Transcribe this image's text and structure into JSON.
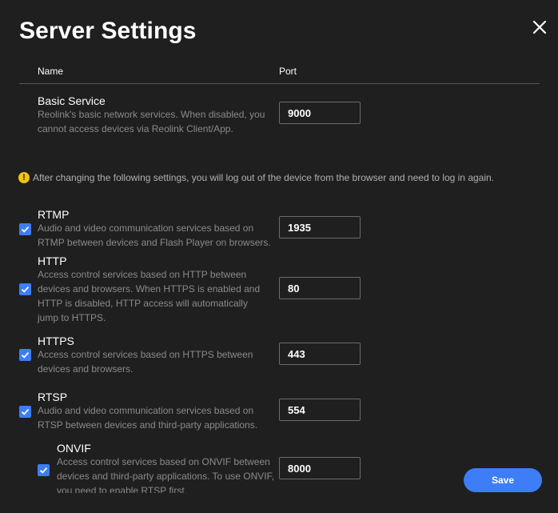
{
  "dialog": {
    "title": "Server Settings",
    "close_icon": "close-icon"
  },
  "table": {
    "col_name": "Name",
    "col_port": "Port"
  },
  "basic_service": {
    "title": "Basic Service",
    "description": "Reolink's basic network services. When disabled, you cannot access devices via Reolink Client/App.",
    "port": "9000"
  },
  "notice": {
    "icon": "warning-icon",
    "text": "After changing the following settings, you will log out of the device from the browser and need to log in again."
  },
  "services": {
    "rtmp": {
      "title": "RTMP",
      "description": "Audio and video communication services based on RTMP between devices and Flash Player on browsers.",
      "port": "1935",
      "enabled": true
    },
    "http": {
      "title": "HTTP",
      "description": "Access control services based on HTTP between devices and browsers. When HTTPS is enabled and HTTP is disabled, HTTP access will automatically jump to HTTPS.",
      "port": "80",
      "enabled": true
    },
    "https": {
      "title": "HTTPS",
      "description": "Access control services based on HTTPS between devices and browsers.",
      "port": "443",
      "enabled": true
    },
    "rtsp": {
      "title": "RTSP",
      "description": "Audio and video communication services based on RTSP between devices and third-party applications.",
      "port": "554",
      "enabled": true
    },
    "onvif": {
      "title": "ONVIF",
      "description": "Access control services based on ONVIF between devices and third-party applications. To use ONVIF, you need to enable RTSP first.",
      "port": "8000",
      "enabled": true
    }
  },
  "footer": {
    "save_label": "Save"
  },
  "colors": {
    "background": "#1f1f1f",
    "accent": "#3d7df6",
    "warning": "#f1c40f",
    "muted_text": "#8a8a8a"
  }
}
